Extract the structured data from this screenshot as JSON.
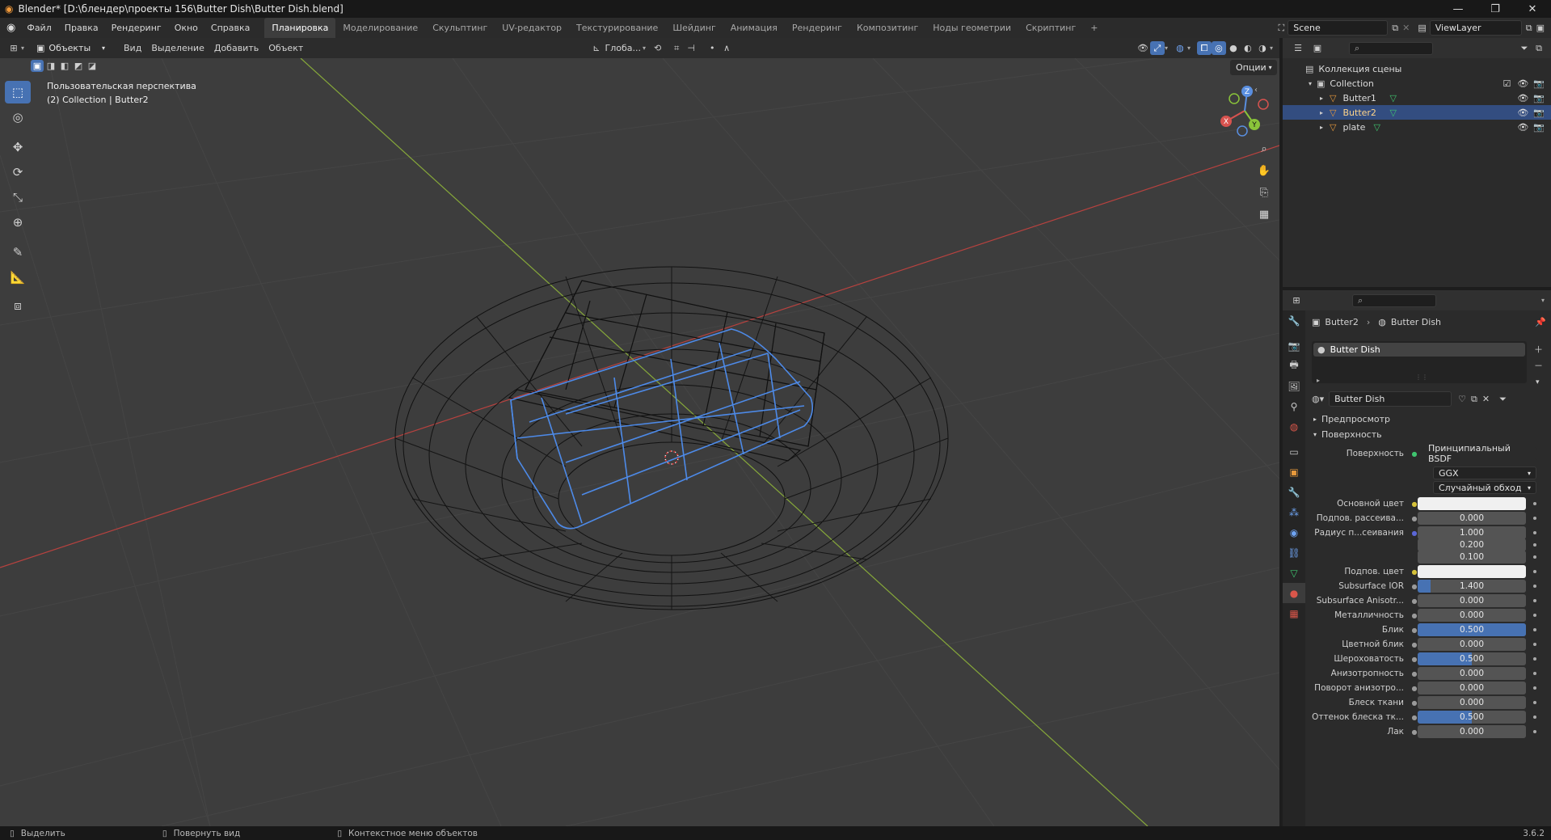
{
  "window": {
    "title": "Blender* [D:\\блендер\\проекты 156\\Butter Dish\\Butter Dish.blend]",
    "controls": [
      "—",
      "❐",
      "✕"
    ]
  },
  "menu": {
    "items": [
      "Файл",
      "Правка",
      "Рендеринг",
      "Окно",
      "Справка"
    ],
    "workspaces": [
      "Планировка",
      "Моделирование",
      "Скульптинг",
      "UV-редактор",
      "Текстурирование",
      "Шейдинг",
      "Анимация",
      "Рендеринг",
      "Композитинг",
      "Ноды геометрии",
      "Скриптинг"
    ],
    "active_workspace": "Планировка",
    "add_tab": "+",
    "scene": "Scene",
    "view_layer": "ViewLayer"
  },
  "viewport_header": {
    "mode": "Объекты",
    "menus": [
      "Вид",
      "Выделение",
      "Добавить",
      "Объект"
    ],
    "orientation": "Глоба...",
    "options": "Опции"
  },
  "viewport": {
    "view_name": "Пользовательская перспектива",
    "collection_info": "(2) Collection | Butter2",
    "gizmo": {
      "x": "X",
      "y": "Y",
      "z": "Z"
    },
    "colors": {
      "bg": "#3d3d3d",
      "x_axis": "#b8423f",
      "y_axis": "#86a83a",
      "selected": "#4d8ae8",
      "wire": "#0f0f0f"
    }
  },
  "outliner": {
    "root": "Коллекция сцены",
    "collection": "Collection",
    "items": [
      {
        "name": "Butter1",
        "selected": false
      },
      {
        "name": "Butter2",
        "selected": true
      },
      {
        "name": "plate",
        "selected": false
      }
    ]
  },
  "properties": {
    "breadcrumb_object": "Butter2",
    "breadcrumb_material": "Butter Dish",
    "slot_name": "Butter Dish",
    "material_name": "Butter Dish",
    "sections": {
      "preview": "Предпросмотр",
      "surface": "Поверхность"
    },
    "surface_label": "Поверхность",
    "surface_value": "Принципиальный BSDF",
    "distribution": "GGX",
    "subsurface_method": "Случайный обход",
    "rows": [
      {
        "label": "Основной цвет",
        "value": "",
        "type": "color",
        "dot": "#d6c23a"
      },
      {
        "label": "Подпов. рассеива...",
        "value": "0.000",
        "type": "num",
        "fill": 0,
        "dot": "#9a9a9a"
      },
      {
        "label": "Радиус п...сеивания",
        "value": "1.000",
        "type": "num",
        "fill": 0,
        "dot": "#5b67d6"
      },
      {
        "label": "",
        "value": "0.200",
        "type": "num",
        "fill": 0,
        "dot": ""
      },
      {
        "label": "",
        "value": "0.100",
        "type": "num",
        "fill": 0,
        "dot": ""
      },
      {
        "label": "Подпов. цвет",
        "value": "",
        "type": "color",
        "dot": "#d6c23a"
      },
      {
        "label": "Subsurface IOR",
        "value": "1.400",
        "type": "num",
        "fill": 0.12,
        "dot": "#9a9a9a"
      },
      {
        "label": "Subsurface Anisotr...",
        "value": "0.000",
        "type": "num",
        "fill": 0,
        "dot": "#9a9a9a"
      },
      {
        "label": "Металличность",
        "value": "0.000",
        "type": "num",
        "fill": 0,
        "dot": "#9a9a9a"
      },
      {
        "label": "Блик",
        "value": "0.500",
        "type": "num",
        "fill": 1.0,
        "dot": "#9a9a9a"
      },
      {
        "label": "Цветной блик",
        "value": "0.000",
        "type": "num",
        "fill": 0,
        "dot": "#9a9a9a"
      },
      {
        "label": "Шероховатость",
        "value": "0.500",
        "type": "num",
        "fill": 0.5,
        "dot": "#9a9a9a"
      },
      {
        "label": "Анизотропность",
        "value": "0.000",
        "type": "num",
        "fill": 0,
        "dot": "#9a9a9a"
      },
      {
        "label": "Поворот анизотро...",
        "value": "0.000",
        "type": "num",
        "fill": 0,
        "dot": "#9a9a9a"
      },
      {
        "label": "Блеск ткани",
        "value": "0.000",
        "type": "num",
        "fill": 0,
        "dot": "#9a9a9a"
      },
      {
        "label": "Оттенок блеска тк...",
        "value": "0.500",
        "type": "num",
        "fill": 0.5,
        "dot": "#9a9a9a"
      },
      {
        "label": "Лак",
        "value": "0.000",
        "type": "num",
        "fill": 0,
        "dot": "#9a9a9a"
      }
    ]
  },
  "statusbar": {
    "select": "Выделить",
    "rotate": "Повернуть вид",
    "context_menu": "Контекстное меню объектов",
    "version": "3.6.2"
  }
}
